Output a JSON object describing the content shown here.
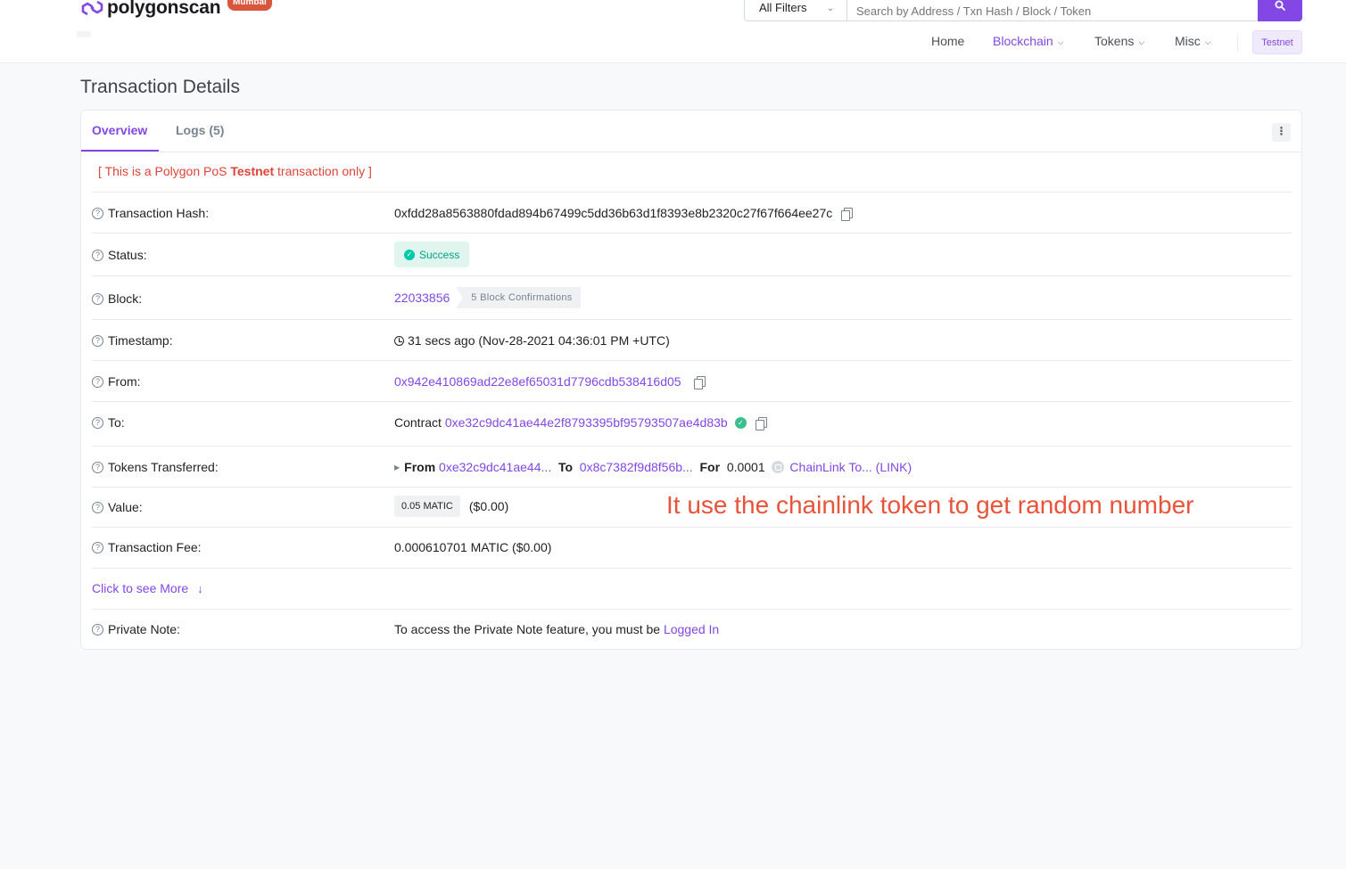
{
  "header": {
    "logo_text": "polygonscan",
    "network_badge": "Mumbai",
    "filter_label": "All Filters",
    "search_placeholder": "Search by Address / Txn Hash / Block / Token",
    "nav": {
      "home": "Home",
      "blockchain": "Blockchain",
      "tokens": "Tokens",
      "misc": "Misc",
      "testnet": "Testnet"
    },
    "accent_color": "#8247e5"
  },
  "page": {
    "title": "Transaction Details"
  },
  "tabs": {
    "overview": "Overview",
    "logs": "Logs (5)"
  },
  "notice": {
    "prefix": "[ This is a Polygon PoS ",
    "bold": "Testnet",
    "suffix": " transaction only ]"
  },
  "details": {
    "tx_hash": {
      "label": "Transaction Hash:",
      "value": "0xfdd28a8563880fdad894b67499c5dd36b63d1f8393e8b2320c27f67f664ee27c"
    },
    "status": {
      "label": "Status:",
      "value": "Success"
    },
    "block": {
      "label": "Block:",
      "value": "22033856",
      "confirmations": "5 Block Confirmations"
    },
    "timestamp": {
      "label": "Timestamp:",
      "value": "31 secs ago (Nov-28-2021 04:36:01 PM +UTC)"
    },
    "from": {
      "label": "From:",
      "value": "0x942e410869ad22e8ef65031d7796cdb538416d05"
    },
    "to": {
      "label": "To:",
      "prefix": "Contract",
      "value": "0xe32c9dc41ae44e2f8793395bf95793507ae4d83b"
    },
    "tokens": {
      "label": "Tokens Transferred:",
      "from_label": "From",
      "from_value": "0xe32c9dc41ae44...",
      "to_label": "To",
      "to_value": "0x8c7382f9d8f56b...",
      "for_label": "For",
      "amount": "0.0001",
      "token": "ChainLink To... (LINK)"
    },
    "value": {
      "label": "Value:",
      "badge": "0.05 MATIC",
      "usd": "($0.00)"
    },
    "fee": {
      "label": "Transaction Fee:",
      "value": "0.000610701 MATIC ($0.00)"
    },
    "more": "Click to see More",
    "private_note": {
      "label": "Private Note:",
      "text": "To access the Private Note feature, you must be ",
      "link": "Logged In"
    }
  },
  "annotation": "It use the chainlink token to get random number",
  "icons": [
    "polygon-logo-icon",
    "chevron-down-icon",
    "search-icon",
    "kebab-menu-icon",
    "help-icon",
    "copy-icon",
    "check-circle-icon",
    "clock-icon",
    "verified-icon",
    "caret-right-icon",
    "token-icon",
    "arrow-down-icon"
  ]
}
